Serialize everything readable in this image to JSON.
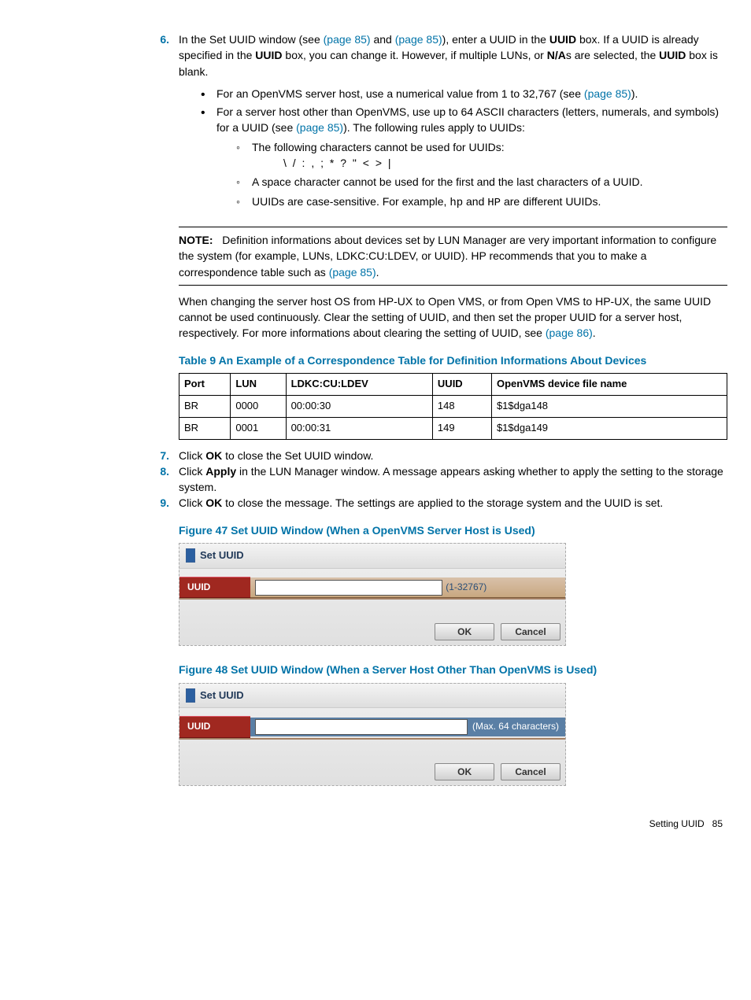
{
  "steps": {
    "s6_num": "6.",
    "s6_text_pre": "In the Set UUID window (see ",
    "s6_link1": "(page 85)",
    "s6_mid1": " and ",
    "s6_link2": "(page 85)",
    "s6_mid2": "), enter a UUID in the ",
    "s6_bold1": "UUID",
    "s6_mid3": " box. If a UUID is already specified in the ",
    "s6_bold2": "UUID",
    "s6_mid4": " box, you can change it. However, if multiple LUNs, or ",
    "s6_bold3": "N/A",
    "s6_mid5": "s are selected, the ",
    "s6_bold4": "UUID",
    "s6_mid6": " box is blank.",
    "b1_pre": "For an OpenVMS server host, use a numerical value from 1 to 32,767 (see ",
    "b1_link": "(page 85)",
    "b1_post": ").",
    "b2_pre": "For a server host other than OpenVMS, use up to 64 ASCII characters (letters, numerals, and symbols) for a UUID (see ",
    "b2_link": "(page 85)",
    "b2_post": "). The following rules apply to UUIDs:",
    "c1": "The following characters cannot be used for UUIDs:",
    "forbidden": "\\ / : , ; * ? \" < > |",
    "c2": "A space character cannot be used for the first and the last characters of a UUID.",
    "c3_pre": "UUIDs are case-sensitive. For example, ",
    "c3_m1": "hp",
    "c3_mid": " and ",
    "c3_m2": "HP",
    "c3_post": " are different UUIDs.",
    "note_label": "NOTE:",
    "note_body_pre": "Definition informations about devices set by LUN Manager are very important information to configure the system (for example, LUNs, LDKC:CU:LDEV, or UUID). HP recommends that you to make a correspondence table such as ",
    "note_link": "(page 85)",
    "note_post": ".",
    "para2_pre": "When changing the server host OS from HP-UX to Open VMS, or from Open VMS to HP-UX, the same UUID cannot be used continuously. Clear the setting of UUID, and then set the proper UUID for a server host, respectively. For more informations about clearing the setting of UUID, see ",
    "para2_link": "(page 86)",
    "para2_post": ".",
    "table_caption": "Table 9 An Example of a Correspondence Table for Definition Informations About Devices",
    "th": {
      "port": "Port",
      "lun": "LUN",
      "ldkc": "LDKC:CU:LDEV",
      "uuid": "UUID",
      "ovms": "OpenVMS device file name"
    },
    "rows": [
      {
        "port": "BR",
        "lun": "0000",
        "ldkc": "00:00:30",
        "uuid": "148",
        "ovms": "$1$dga148"
      },
      {
        "port": "BR",
        "lun": "0001",
        "ldkc": "00:00:31",
        "uuid": "149",
        "ovms": "$1$dga149"
      }
    ],
    "s7_num": "7.",
    "s7_pre": "Click ",
    "s7_bold": "OK",
    "s7_post": " to close the Set UUID window.",
    "s8_num": "8.",
    "s8_pre": "Click ",
    "s8_bold": "Apply",
    "s8_post": " in the LUN Manager window. A message appears asking whether to apply the setting to the storage system.",
    "s9_num": "9.",
    "s9_pre": "Click ",
    "s9_bold": "OK",
    "s9_post": " to close the message. The settings are applied to the storage system and the UUID is set.",
    "fig47_caption": "Figure 47 Set UUID Window (When a OpenVMS Server Host is Used)",
    "fig48_caption": "Figure 48 Set UUID Window (When a Server Host Other Than OpenVMS is Used)",
    "dlg_title": "Set UUID",
    "dlg_field": "UUID",
    "dlg_hint1": "(1-32767)",
    "dlg_hint2": "(Max. 64 characters)",
    "btn_ok": "OK",
    "btn_cancel": "Cancel",
    "footer": "Setting UUID",
    "pagenum": "85"
  }
}
